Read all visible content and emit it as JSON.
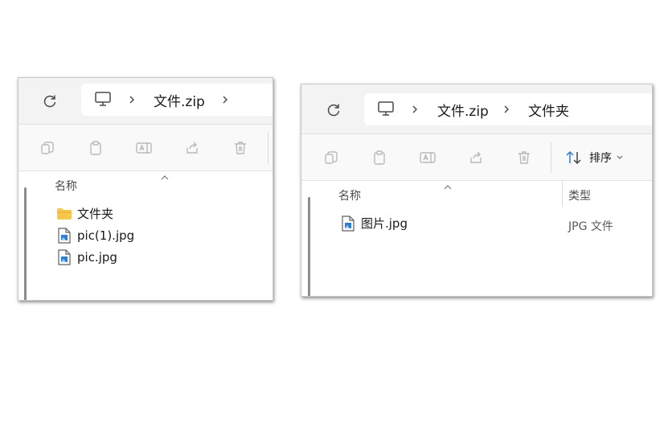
{
  "left_window": {
    "breadcrumb": {
      "items": [
        "文件.zip"
      ]
    },
    "header": {
      "name_col": "名称"
    },
    "files": [
      {
        "name": "文件夹",
        "kind": "folder"
      },
      {
        "name": "pic(1).jpg",
        "kind": "image"
      },
      {
        "name": "pic.jpg",
        "kind": "image"
      }
    ]
  },
  "right_window": {
    "breadcrumb": {
      "items": [
        "文件.zip",
        "文件夹"
      ]
    },
    "toolbar": {
      "sort_label": "排序"
    },
    "header": {
      "name_col": "名称",
      "type_col": "类型"
    },
    "files": [
      {
        "name": "图片.jpg",
        "type": "JPG 文件",
        "kind": "image"
      }
    ]
  },
  "colors": {
    "accent": "#2f7fd1",
    "folder": "#f5c84c",
    "icon_disabled": "#b9b9b9"
  }
}
